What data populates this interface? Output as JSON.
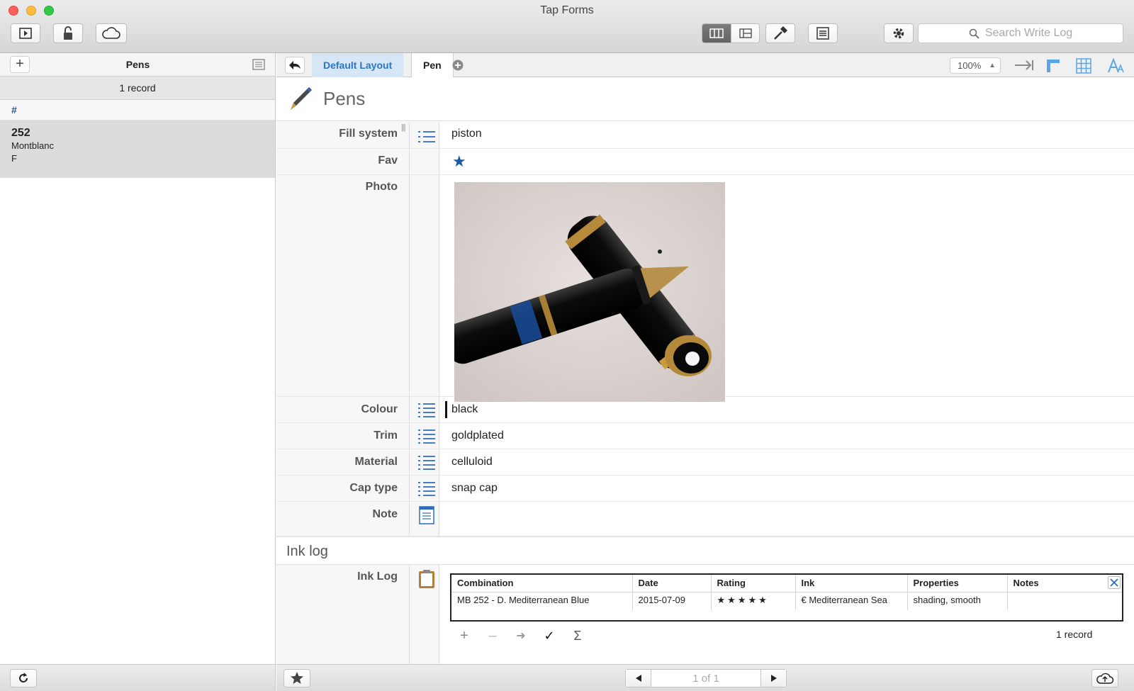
{
  "window": {
    "title": "Tap Forms"
  },
  "toolbar": {
    "search_placeholder": "Search Write Log"
  },
  "left": {
    "title": "Pens",
    "add_label": "+",
    "record_count": "1 record",
    "section_header": "#",
    "records": [
      {
        "line1": "252",
        "line2": "Montblanc",
        "line3": "F"
      }
    ]
  },
  "tabs": {
    "layout": "Default Layout",
    "form": "Pen"
  },
  "zoom": {
    "value": "100%"
  },
  "form": {
    "title": "Pens",
    "fields": [
      {
        "label": "Fill system",
        "value": "piston",
        "icon": "pick-list-icon"
      },
      {
        "label": "Fav",
        "value": "★",
        "icon": ""
      },
      {
        "label": "Photo",
        "value": "",
        "icon": ""
      },
      {
        "label": "Colour",
        "value": "black",
        "icon": "pick-list-icon"
      },
      {
        "label": "Trim",
        "value": "goldplated",
        "icon": "pick-list-icon"
      },
      {
        "label": "Material",
        "value": "celluloid",
        "icon": "pick-list-icon"
      },
      {
        "label": "Cap type",
        "value": "snap cap",
        "icon": "pick-list-icon"
      },
      {
        "label": "Note",
        "value": "",
        "icon": "note-icon"
      }
    ]
  },
  "inklog": {
    "section_title": "Ink log",
    "field_label": "Ink Log",
    "columns": [
      "Combination",
      "Date",
      "Rating",
      "Ink",
      "Properties",
      "Notes"
    ],
    "rows": [
      [
        "MB 252 - D. Mediterranean Blue",
        "2015-07-09",
        "★★★★★",
        "€ Mediterranean Sea",
        "shading, smooth",
        ""
      ]
    ],
    "tools": [
      "+",
      "–",
      "➜",
      "✓",
      "Σ"
    ],
    "record_count": "1 record"
  },
  "pager": {
    "text": "1 of 1"
  },
  "colors": {
    "accent": "#2b76c4",
    "star": "#1a5aa0"
  }
}
